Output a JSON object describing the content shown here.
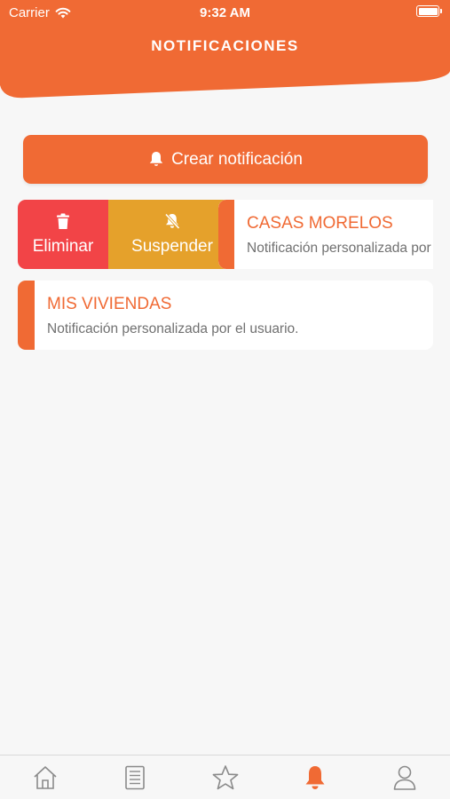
{
  "status_bar": {
    "carrier": "Carrier",
    "time": "9:32 AM"
  },
  "header": {
    "title": "NOTIFICACIONES",
    "color": "#f06a34"
  },
  "create_button": {
    "label": "Crear notificación",
    "icon": "bell-icon"
  },
  "swiped_item": {
    "actions": [
      {
        "label": "Eliminar",
        "icon": "trash-icon",
        "color": "#f24447"
      },
      {
        "label": "Suspender",
        "icon": "bell-slash-icon",
        "color": "#e5a12b"
      }
    ],
    "title": "CASAS MORELOS",
    "subtitle": "Notificación personalizada por el usuario."
  },
  "notifications": [
    {
      "title": "MIS VIVIENDAS",
      "subtitle": "Notificación personalizada por el usuario."
    }
  ],
  "tabbar": {
    "items": [
      {
        "icon": "home-icon",
        "active": false
      },
      {
        "icon": "document-icon",
        "active": false
      },
      {
        "icon": "star-icon",
        "active": false
      },
      {
        "icon": "bell-icon",
        "active": true
      },
      {
        "icon": "user-icon",
        "active": false
      }
    ],
    "active_color": "#f06a34",
    "inactive_color": "#8a8a8a"
  }
}
